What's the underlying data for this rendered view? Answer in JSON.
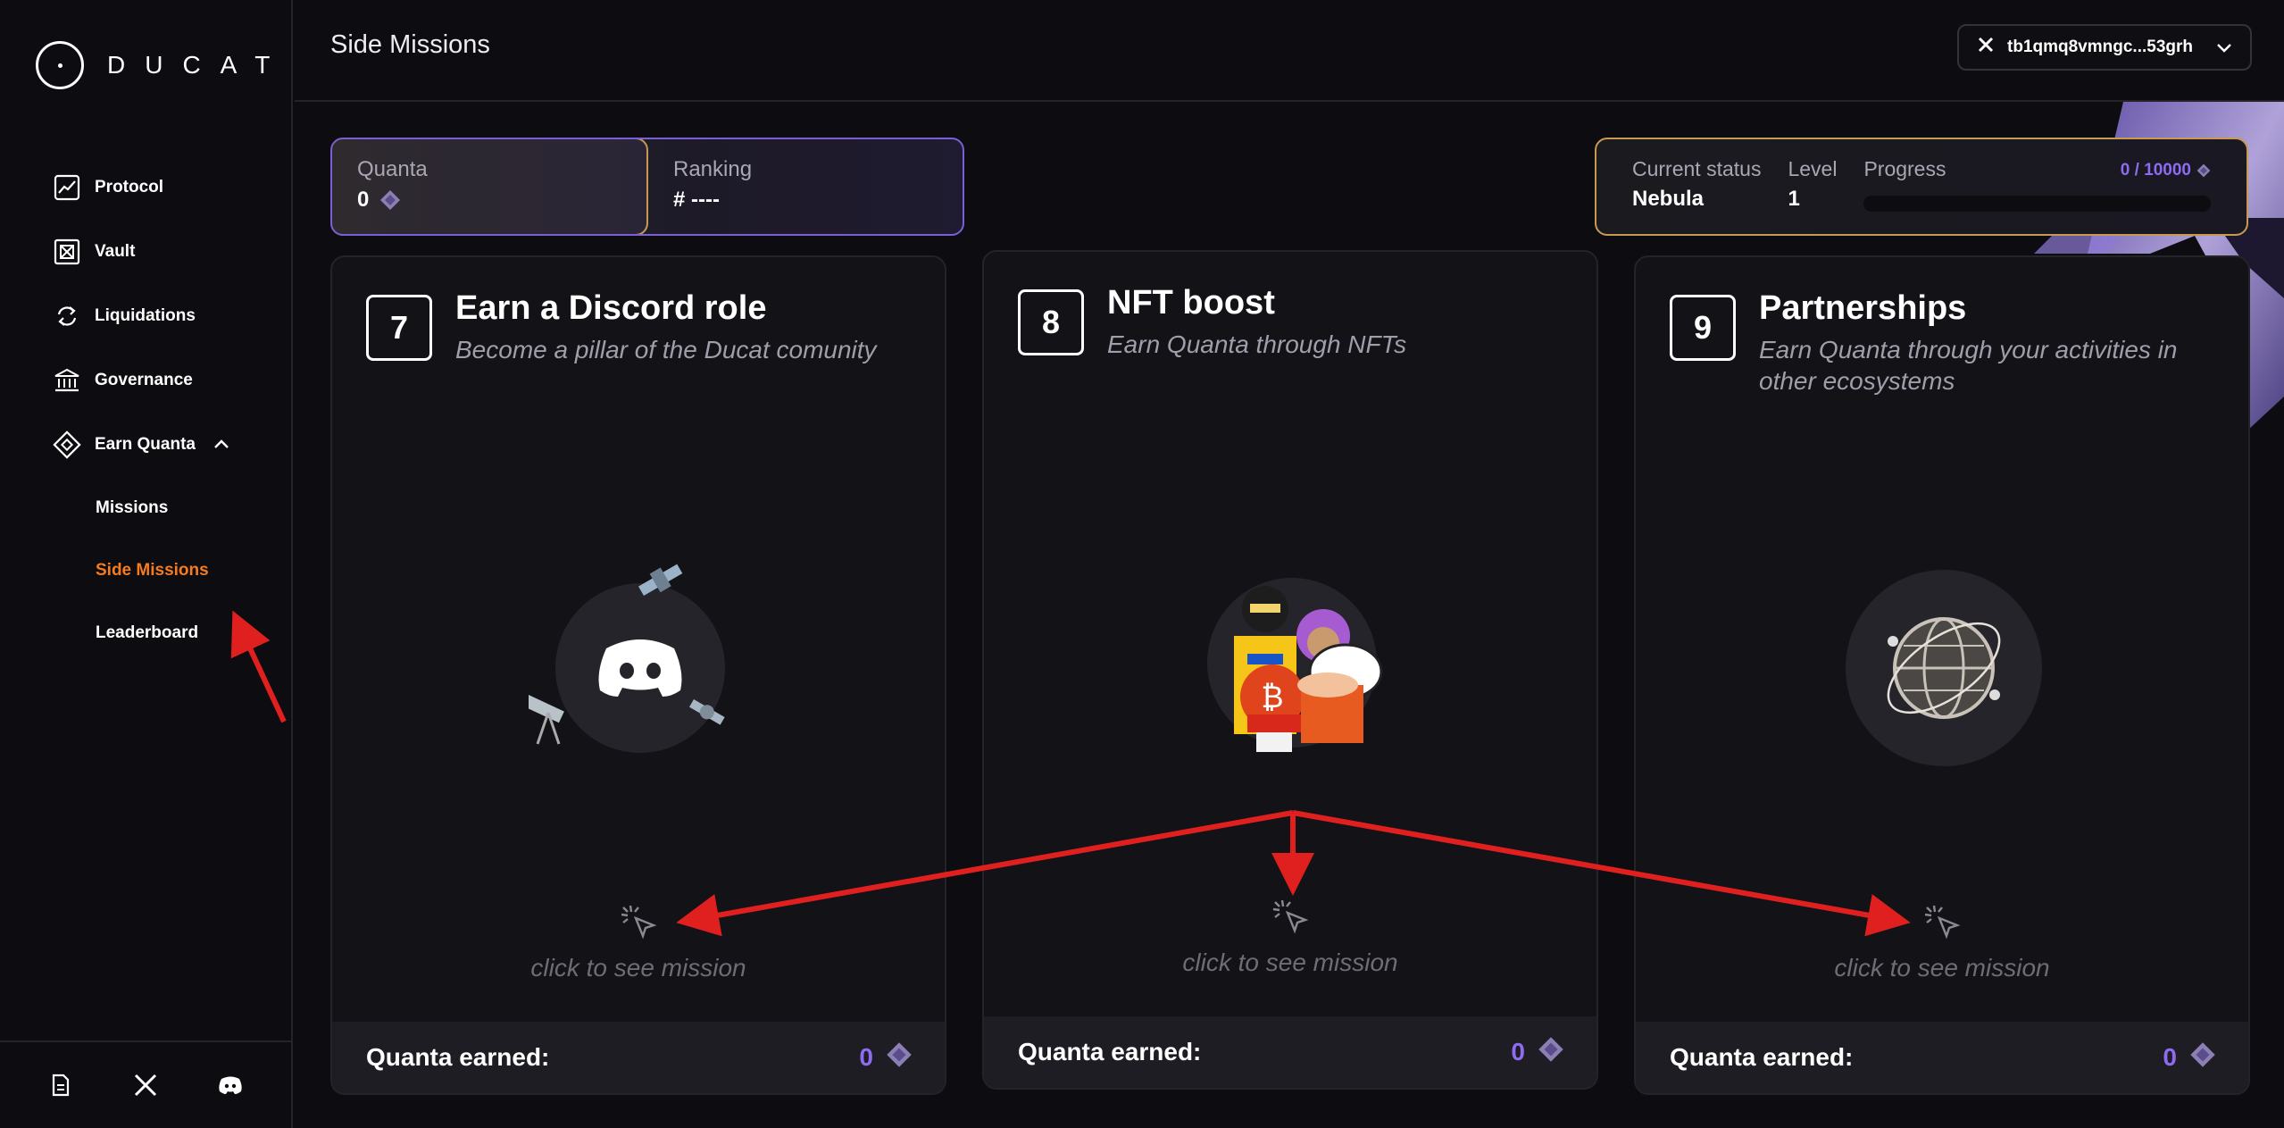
{
  "app": {
    "logo_text": "DUCAT"
  },
  "sidebar": {
    "items": [
      {
        "label": "Protocol",
        "icon": "chart-line-icon"
      },
      {
        "label": "Vault",
        "icon": "vault-icon"
      },
      {
        "label": "Liquidations",
        "icon": "refresh-icon"
      },
      {
        "label": "Governance",
        "icon": "bank-icon"
      },
      {
        "label": "Earn Quanta",
        "icon": "diamond-icon",
        "expanded": true
      }
    ],
    "sub_items": [
      {
        "label": "Missions",
        "active": false
      },
      {
        "label": "Side Missions",
        "active": true
      },
      {
        "label": "Leaderboard",
        "active": false
      }
    ],
    "bottom_icons": [
      "document-icon",
      "x-icon",
      "discord-icon"
    ]
  },
  "header": {
    "title": "Side Missions",
    "wallet_label": "tb1qmq8vmngc...53grh"
  },
  "stats": {
    "quanta_label": "Quanta",
    "quanta_value": "0",
    "ranking_label": "Ranking",
    "ranking_value": "# ----",
    "status_label": "Current status",
    "status_value": "Nebula",
    "level_label": "Level",
    "level_value": "1",
    "progress_label": "Progress",
    "progress_text": "0 / 10000",
    "progress_fraction": 0.0
  },
  "cards": [
    {
      "number": "7",
      "title": "Earn a Discord role",
      "subtitle": "Become a pillar of the Ducat comunity",
      "cta": "click to see mission",
      "footer_label": "Quanta earned:",
      "footer_value": "0"
    },
    {
      "number": "8",
      "title": "NFT boost",
      "subtitle": "Earn Quanta through NFTs",
      "cta": "click to see mission",
      "footer_label": "Quanta earned:",
      "footer_value": "0"
    },
    {
      "number": "9",
      "title": "Partnerships",
      "subtitle": "Earn Quanta through your activities in other ecosystems",
      "cta": "click to see mission",
      "footer_label": "Quanta earned:",
      "footer_value": "0"
    }
  ],
  "colors": {
    "accent_purple": "#8d6cf2",
    "active_orange": "#f47b20",
    "border_gold": "#c59a52",
    "annotation_red": "#e0201e"
  }
}
